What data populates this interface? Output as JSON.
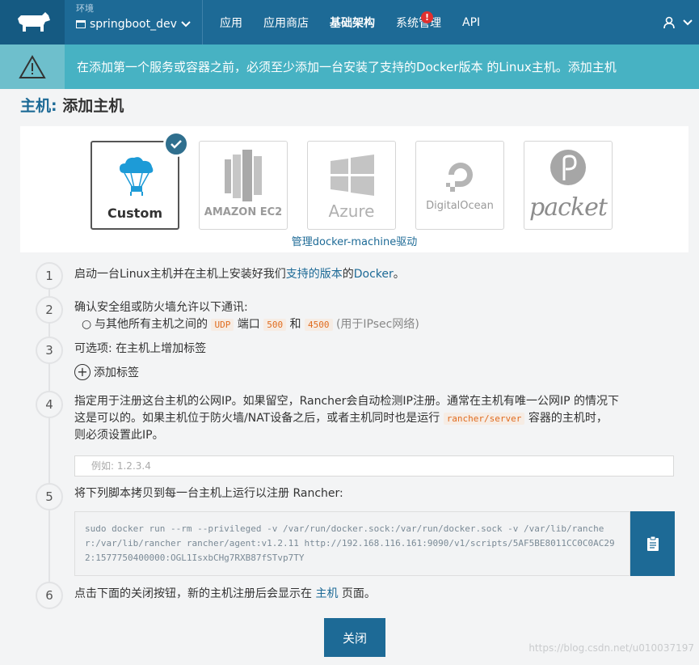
{
  "header": {
    "env_label": "环境",
    "env_value": "springboot_dev",
    "nav": [
      {
        "label": "应用",
        "active": false
      },
      {
        "label": "应用商店",
        "active": false
      },
      {
        "label": "基础架构",
        "active": true
      },
      {
        "label": "系统管理",
        "active": false
      },
      {
        "label": "API",
        "active": false
      }
    ],
    "alert_badge": "!"
  },
  "warning": {
    "text_before": "在添加第一个服务或容器之前，必须至少添加一台安装了",
    "link_docker": "支持的Docker版本",
    "text_middle": " 的Linux主机。",
    "link_add": "添加主机"
  },
  "page": {
    "title_prefix": "主机:",
    "title": " 添加主机"
  },
  "providers": {
    "items": [
      {
        "label": "Custom",
        "selected": true
      },
      {
        "label": "AMAZON EC2",
        "selected": false
      },
      {
        "label": "Azure",
        "selected": false
      },
      {
        "label": "DigitalOcean",
        "selected": false
      },
      {
        "label": "packet",
        "selected": false
      }
    ],
    "manage_link": "管理docker-machine驱动"
  },
  "steps": {
    "s1": {
      "num": "1",
      "text_before": "启动一台Linux主机并在主机上安装好我们",
      "link1": "支持的版本",
      "text_mid": "的",
      "link2": "Docker",
      "text_after": "。"
    },
    "s2": {
      "num": "2",
      "title": "确认安全组或防火墙允许以下通讯:",
      "bullet_before": "与其他所有主机之间的 ",
      "udp": "UDP",
      "port_word": " 端口 ",
      "port1": "500",
      "and_word": " 和 ",
      "port2": "4500",
      "note": " (用于IPsec网络)"
    },
    "s3": {
      "num": "3",
      "title": "可选项: 在主机上增加标签",
      "add_label": "添加标签"
    },
    "s4": {
      "num": "4",
      "line1": "指定用于注册这台主机的公网IP。如果留空，Rancher会自动检测IP注册。通常在主机有唯一公网IP 的情况下",
      "line2_before": "这是可以的。如果主机位于防火墙/NAT设备之后，或者主机同时也是运行 ",
      "code": "rancher/server",
      "line2_after": " 容器的主机时，",
      "line3": "则必须设置此IP。",
      "placeholder": "例如: 1.2.3.4"
    },
    "s5": {
      "num": "5",
      "title": "将下列脚本拷贝到每一台主机上运行以注册 Rancher:",
      "command": "sudo docker run --rm --privileged -v /var/run/docker.sock:/var/run/docker.sock -v /var/lib/rancher:/var/lib/rancher rancher/agent:v1.2.11 http://192.168.116.161:9090/v1/scripts/5AF5BE8011CC0C0AC292:1577750400000:OGL1IsxbCHg7RXB87fSTvp7TY"
    },
    "s6": {
      "num": "6",
      "text_before": "点击下面的关闭按钮，新的主机注册后会显示在 ",
      "link": "主机",
      "text_after": " 页面。"
    }
  },
  "close_button": "关闭",
  "watermark": "https://blog.csdn.net/u010037197",
  "colors": {
    "primary": "#1d6a96",
    "warning": "#47b2c3",
    "code_orange": "#e06c1f"
  }
}
